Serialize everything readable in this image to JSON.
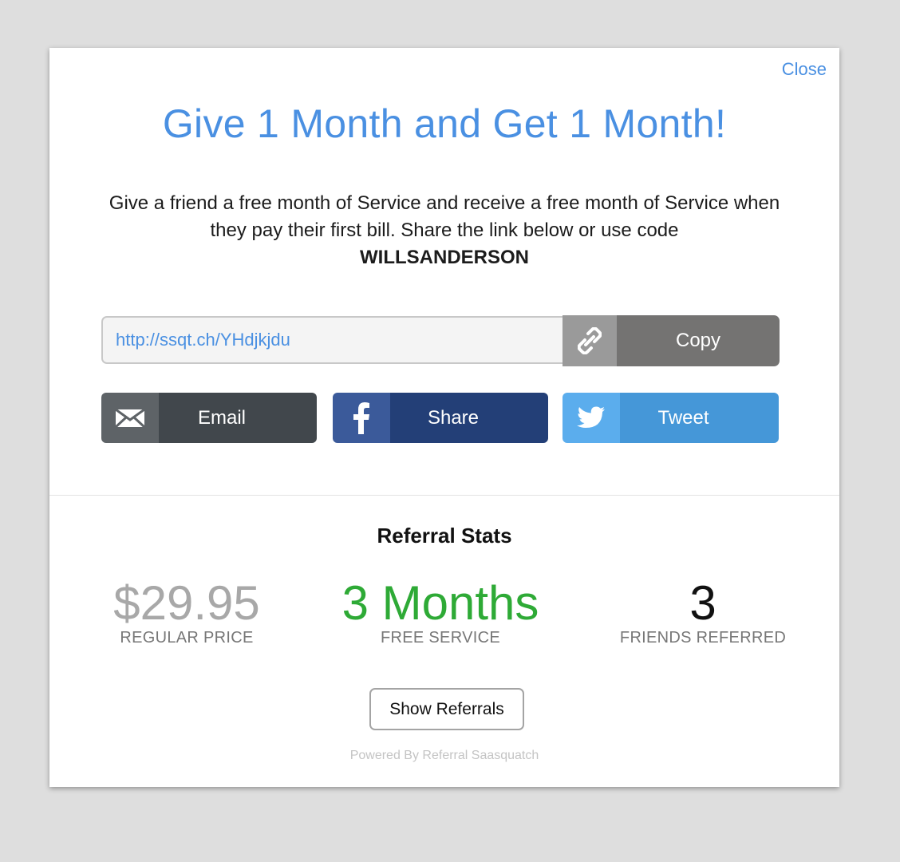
{
  "modal": {
    "close_label": "Close",
    "headline": "Give 1 Month and Get 1 Month!",
    "description": "Give a friend a free month of Service and receive a free month of Service when they pay their first bill. Share the link below or use code",
    "referral_code": "WILLSANDERSON"
  },
  "share_link": {
    "url": "http://ssqt.ch/YHdjkjdu",
    "link_icon": "link-icon",
    "copy_label": "Copy"
  },
  "share_buttons": {
    "email": {
      "label": "Email",
      "icon": "envelope-icon"
    },
    "facebook": {
      "label": "Share",
      "icon": "facebook-icon"
    },
    "twitter": {
      "label": "Tweet",
      "icon": "twitter-bird-icon"
    }
  },
  "stats": {
    "title": "Referral Stats",
    "regular_price": {
      "value": "$29.95",
      "caption": "REGULAR PRICE"
    },
    "free_service": {
      "value": "3 Months",
      "caption": "FREE SERVICE"
    },
    "friends_referred": {
      "value": "3",
      "caption": "FRIENDS REFERRED"
    }
  },
  "show_referrals_label": "Show Referrals",
  "powered_by": "Powered By Referral Saasquatch",
  "colors": {
    "accent_blue": "#4a90e2",
    "free_green": "#2eaa36",
    "copy_gray": "#747372",
    "email_dark": "#41474c",
    "facebook_navy": "#233f77",
    "twitter_blue": "#4597d8",
    "backdrop": "#dedede"
  }
}
